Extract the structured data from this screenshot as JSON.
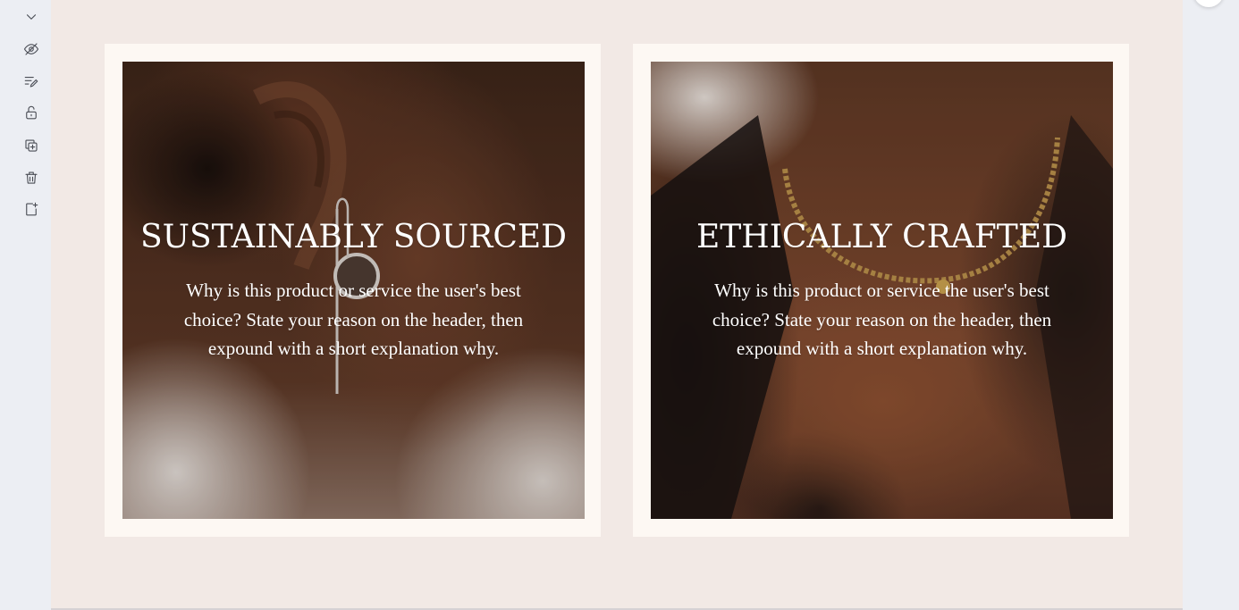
{
  "toolbar": {
    "items": [
      {
        "name": "collapse",
        "icon": "chevron-down-icon"
      },
      {
        "name": "hide",
        "icon": "eye-slash-icon"
      },
      {
        "name": "edit",
        "icon": "edit-lines-icon"
      },
      {
        "name": "lock",
        "icon": "unlock-icon"
      },
      {
        "name": "duplicate",
        "icon": "duplicate-icon"
      },
      {
        "name": "delete",
        "icon": "trash-icon"
      },
      {
        "name": "add-page",
        "icon": "add-page-icon"
      }
    ]
  },
  "cards": [
    {
      "title": "SUSTAINABLY SOURCED",
      "body": "Why is this product or service the user's best choice? State your reason on the header, then expound with a short explanation why.",
      "image_subject": "ear with earring"
    },
    {
      "title": "ETHICALLY CRAFTED",
      "body": "Why is this product or service the user's best choice? State your reason on the header, then expound with a short explanation why.",
      "image_subject": "neck with gold chain necklace"
    }
  ],
  "colors": {
    "canvas": "#f2e9e5",
    "card_frame": "#fdf8f3",
    "app_background": "#eceef3",
    "text_on_image": "#ffffff"
  }
}
